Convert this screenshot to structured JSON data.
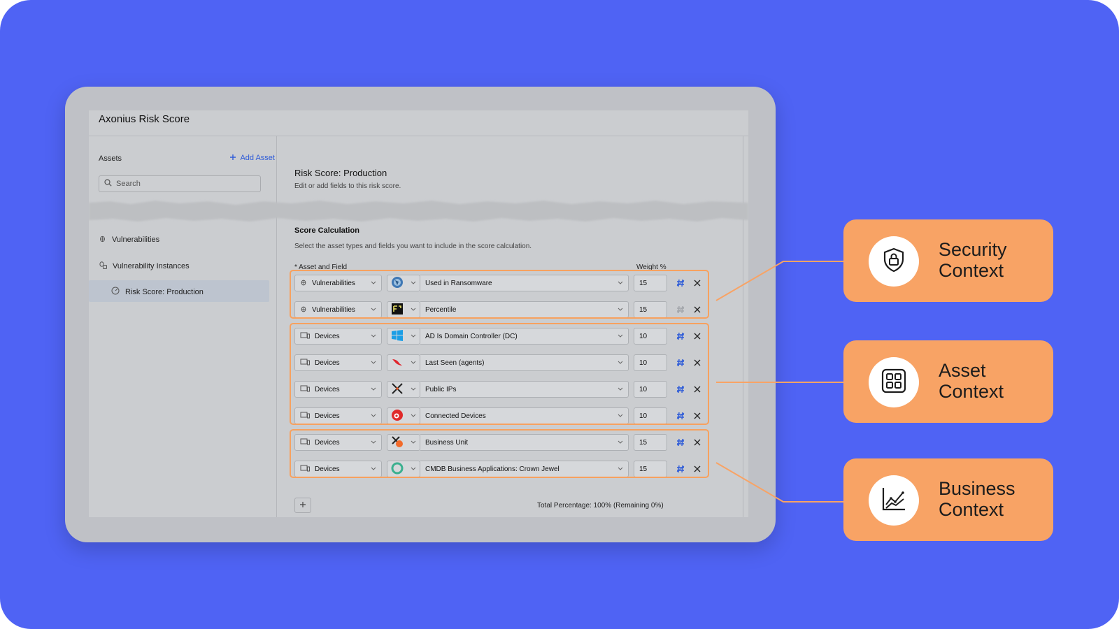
{
  "window": {
    "title": "Axonius Risk Score"
  },
  "sidebar": {
    "assets_label": "Assets",
    "add_asset_label": "Add Asset",
    "search_placeholder": "Search",
    "items": [
      {
        "label": "Vulnerabilities",
        "icon": "bug-icon"
      },
      {
        "label": "Vulnerability Instances",
        "icon": "bug-instances-icon"
      },
      {
        "label": "Risk Score: Production",
        "icon": "gauge-icon",
        "selected": true
      }
    ]
  },
  "main": {
    "title": "Risk Score: Production",
    "subtitle": "Edit or add fields to this risk score.",
    "section_title": "Score Calculation",
    "section_subtitle": "Select the asset types and fields you want to include in the score calculation.",
    "col_asset_field": "* Asset and Field",
    "col_weight": "Weight %",
    "rows": [
      {
        "asset": "Vulnerabilities",
        "adapter_icon": "globe-adapter-icon",
        "field": "Used in Ransomware",
        "weight": "15"
      },
      {
        "asset": "Vulnerabilities",
        "adapter_icon": "first-adapter-icon",
        "field": "Percentile",
        "weight": "15"
      },
      {
        "asset": "Devices",
        "adapter_icon": "windows-adapter-icon",
        "field": "AD Is Domain Controller (DC)",
        "weight": "10"
      },
      {
        "asset": "Devices",
        "adapter_icon": "falcon-adapter-icon",
        "field": "Last Seen (agents)",
        "weight": "10"
      },
      {
        "asset": "Devices",
        "adapter_icon": "x-adapter-icon",
        "field": "Public IPs",
        "weight": "10"
      },
      {
        "asset": "Devices",
        "adapter_icon": "red-circle-adapter-icon",
        "field": "Connected Devices",
        "weight": "10"
      },
      {
        "asset": "Devices",
        "adapter_icon": "x-orange-adapter-icon",
        "field": "Business Unit",
        "weight": "15"
      },
      {
        "asset": "Devices",
        "adapter_icon": "ring-adapter-icon",
        "field": "CMDB Business Applications: Crown Jewel",
        "weight": "15"
      }
    ],
    "total": "Total Percentage: 100% (Remaining 0%)"
  },
  "callouts": [
    {
      "line1": "Security",
      "line2": "Context",
      "icon": "shield-lock-icon"
    },
    {
      "line1": "Asset",
      "line2": "Context",
      "icon": "grid-icon"
    },
    {
      "line1": "Business",
      "line2": "Context",
      "icon": "trend-chart-icon"
    }
  ],
  "colors": {
    "background": "#4f63f4",
    "accent": "#f8a365",
    "link": "#2f5cd8"
  }
}
